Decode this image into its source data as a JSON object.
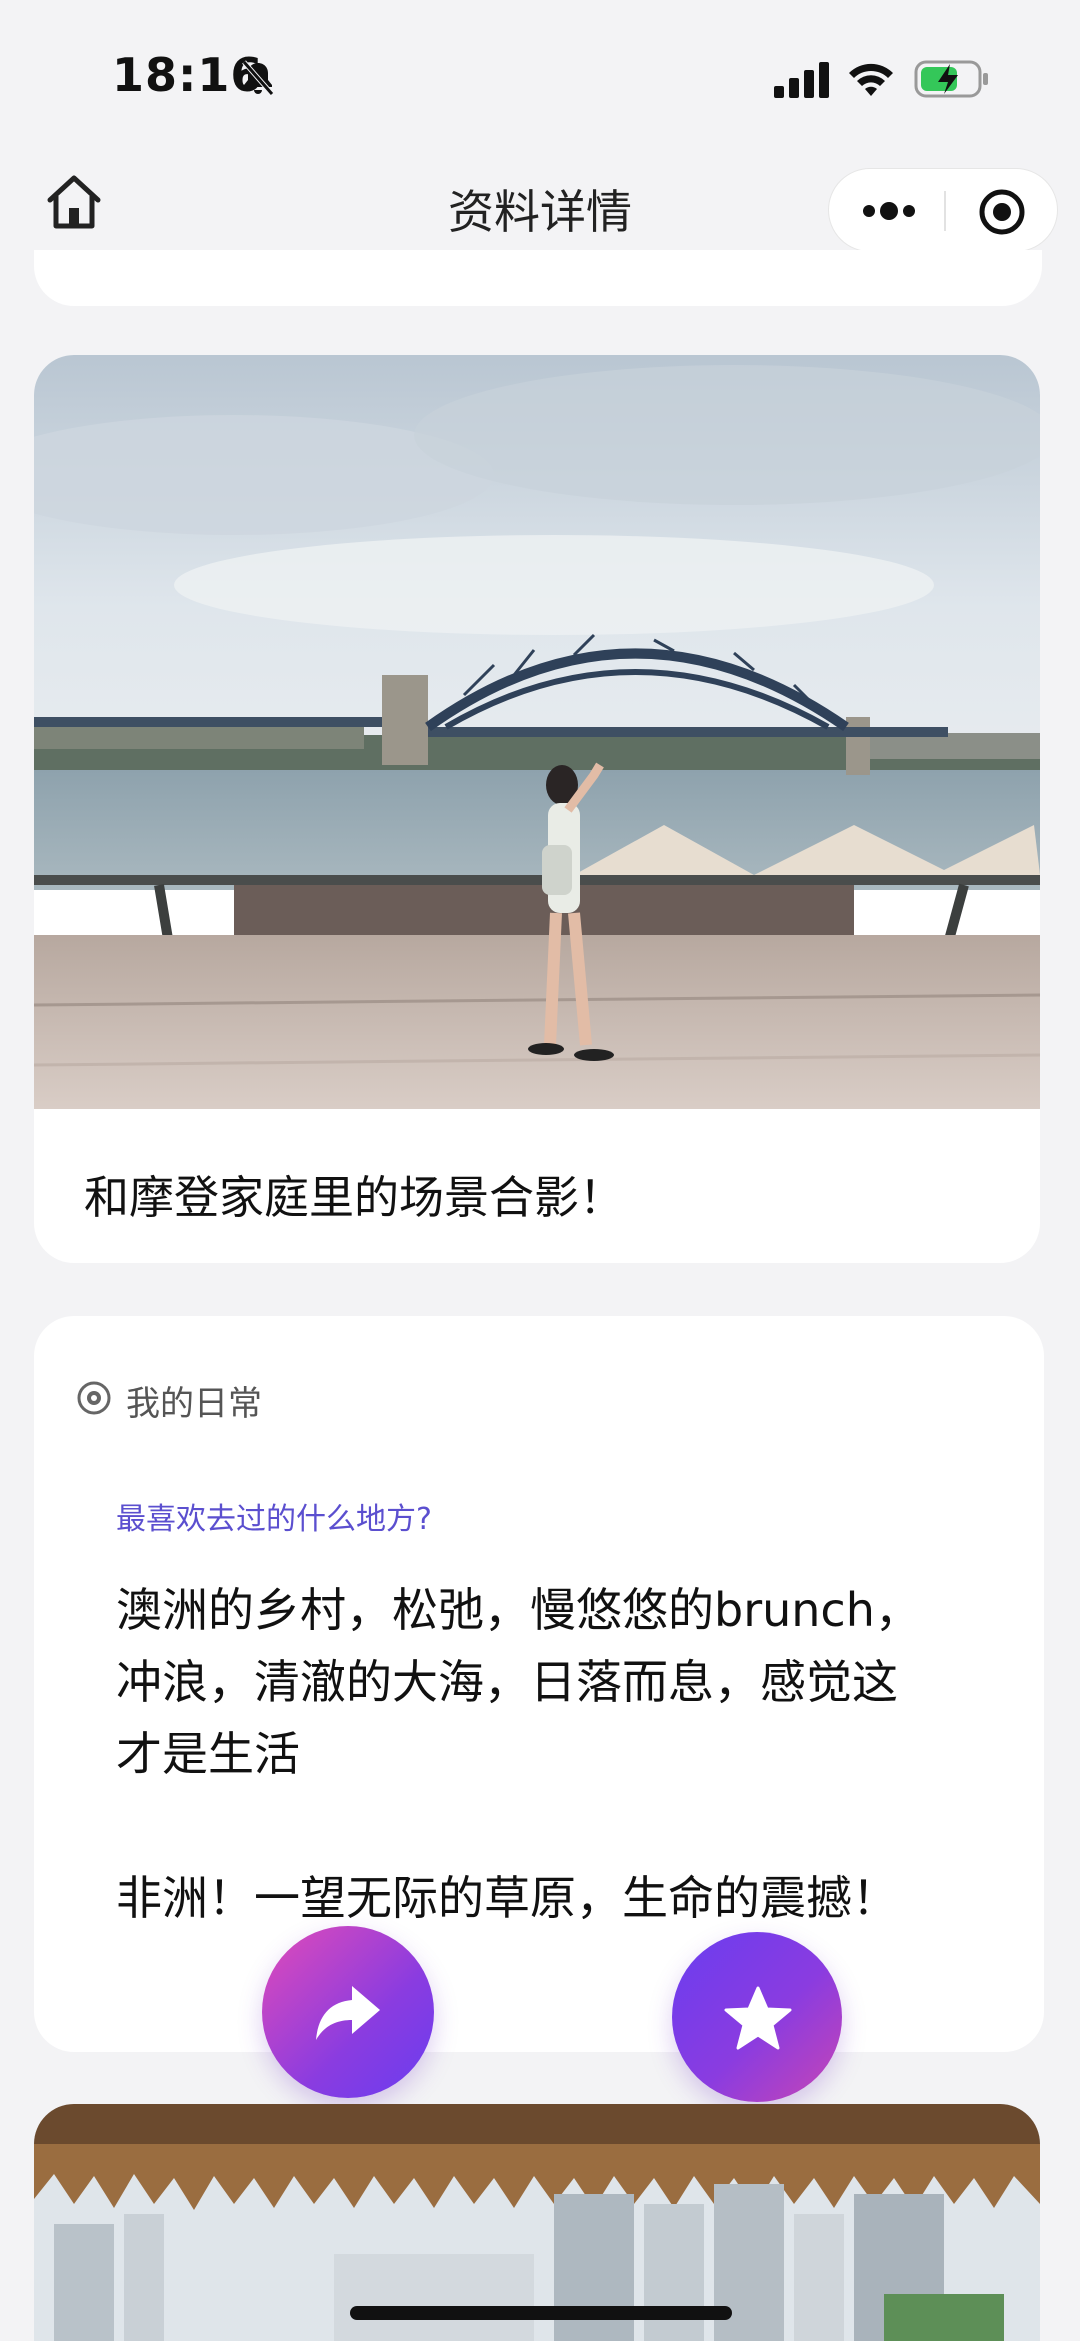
{
  "status_bar": {
    "time": "18:16",
    "icons": [
      "bell-slash-icon",
      "signal-icon",
      "wifi-icon",
      "battery-charging-icon"
    ]
  },
  "nav": {
    "title": "资料详情",
    "home_icon": "home-icon",
    "more_icon": "more-dots-icon",
    "close_icon": "target-circle-icon"
  },
  "photo_card": {
    "caption": "和摩登家庭里的场景合影！"
  },
  "daily_card": {
    "section_label": "我的日常",
    "question": "最喜欢去过的什么地方?",
    "answer": "澳洲的乡村，松弛，慢悠悠的brunch，\n冲浪，清澈的大海，日落而息，感觉这\n才是生活\n\n非洲！一望无际的草原，生命的震撼！"
  },
  "actions": {
    "share_icon": "share-arrow-icon",
    "star_icon": "star-icon"
  },
  "colors": {
    "accent": "#5b4fcf",
    "gradient_start": "#e24bb8",
    "gradient_end": "#6a3df0"
  }
}
